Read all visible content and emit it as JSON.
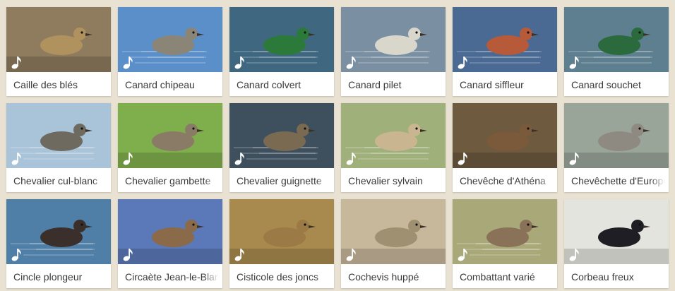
{
  "birds": [
    {
      "name": "Caille des blés",
      "bg": "#8f7b5e",
      "water": false,
      "body": "#b0925f"
    },
    {
      "name": "Canard chipeau",
      "bg": "#5b8fc9",
      "water": true,
      "body": "#8a8577"
    },
    {
      "name": "Canard colvert",
      "bg": "#3f6880",
      "water": true,
      "body": "#2c7a3a"
    },
    {
      "name": "Canard pilet",
      "bg": "#7a8fa2",
      "water": true,
      "body": "#d9d6cc"
    },
    {
      "name": "Canard siffleur",
      "bg": "#4a6a94",
      "water": true,
      "body": "#b65a3a"
    },
    {
      "name": "Canard souchet",
      "bg": "#5e7f8f",
      "water": true,
      "body": "#2b6a3c"
    },
    {
      "name": "Chevalier cul-blanc",
      "bg": "#a9c3d8",
      "water": true,
      "body": "#6f6a5f"
    },
    {
      "name": "Chevalier gambette",
      "bg": "#7fae4d",
      "water": false,
      "body": "#8a7b66"
    },
    {
      "name": "Chevalier guignette",
      "bg": "#3e4f5e",
      "water": true,
      "body": "#7a6a52"
    },
    {
      "name": "Chevalier sylvain",
      "bg": "#9fb07a",
      "water": true,
      "body": "#c9b58f"
    },
    {
      "name": "Chevêche d'Athéna",
      "bg": "#6e5a3f",
      "water": false,
      "body": "#7a5a3a"
    },
    {
      "name": "Chevêchette d'Europe",
      "bg": "#9aa59a",
      "water": false,
      "body": "#8e8a82"
    },
    {
      "name": "Cincle plongeur",
      "bg": "#4f7ea6",
      "water": true,
      "body": "#3a2f2a"
    },
    {
      "name": "Circaète Jean-le-Blanc",
      "bg": "#5b78b8",
      "water": false,
      "body": "#8a6a48"
    },
    {
      "name": "Cisticole des joncs",
      "bg": "#a88a4e",
      "water": false,
      "body": "#9c7a45"
    },
    {
      "name": "Cochevis huppé",
      "bg": "#c7b79b",
      "water": false,
      "body": "#a09072"
    },
    {
      "name": "Combattant varié",
      "bg": "#a8a878",
      "water": true,
      "body": "#8a7258"
    },
    {
      "name": "Corbeau freux",
      "bg": "#e4e4df",
      "water": false,
      "body": "#1e1e24"
    }
  ],
  "icons": {
    "play": "music-note-icon"
  }
}
